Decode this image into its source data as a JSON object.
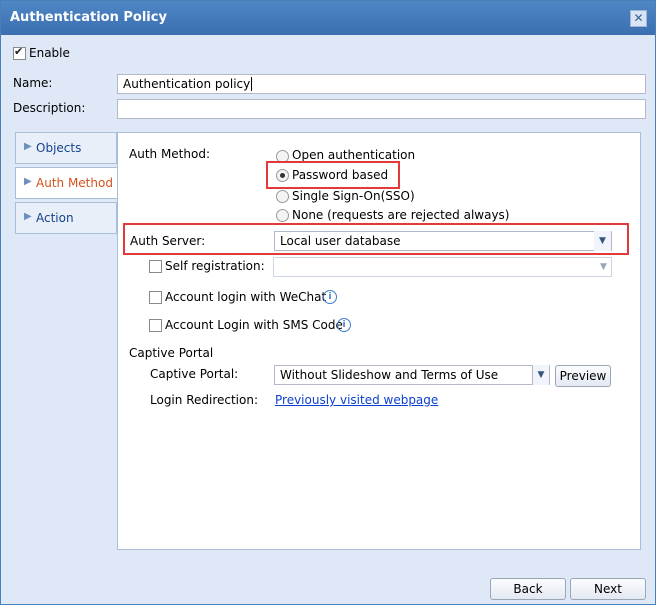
{
  "dialog": {
    "title": "Authentication Policy",
    "close_icon": "close-icon"
  },
  "enable": {
    "label": "Enable",
    "checked": true
  },
  "name": {
    "label": "Name:",
    "value": "Authentication policy"
  },
  "description": {
    "label": "Description:",
    "value": ""
  },
  "tabs": [
    {
      "label": "Objects",
      "active": false
    },
    {
      "label": "Auth Method",
      "active": true
    },
    {
      "label": "Action",
      "active": false
    }
  ],
  "auth_method": {
    "label": "Auth Method:",
    "options": [
      {
        "label": "Open authentication",
        "selected": false
      },
      {
        "label": "Password based",
        "selected": true
      },
      {
        "label": "Single Sign-On(SSO)",
        "selected": false
      },
      {
        "label": "None (requests are rejected always)",
        "selected": false
      }
    ]
  },
  "auth_server": {
    "label": "Auth Server:",
    "value": "Local user database"
  },
  "self_registration": {
    "label": "Self registration:",
    "checked": false,
    "value": ""
  },
  "wechat_login": {
    "label": "Account login with WeChat",
    "checked": false
  },
  "sms_login": {
    "label": "Account Login with SMS Code",
    "checked": false
  },
  "captive_portal": {
    "section_label": "Captive Portal",
    "field_label": "Captive Portal:",
    "value": "Without Slideshow and Terms of Use",
    "preview_label": "Preview"
  },
  "login_redirection": {
    "label": "Login Redirection:",
    "link": "Previously visited webpage"
  },
  "footer": {
    "back_label": "Back",
    "next_label": "Next"
  },
  "colors": {
    "title_bar": "#3f76b8",
    "highlight": "#e23a3a",
    "link": "#0b3fd0",
    "active_tab": "#d2541e"
  }
}
